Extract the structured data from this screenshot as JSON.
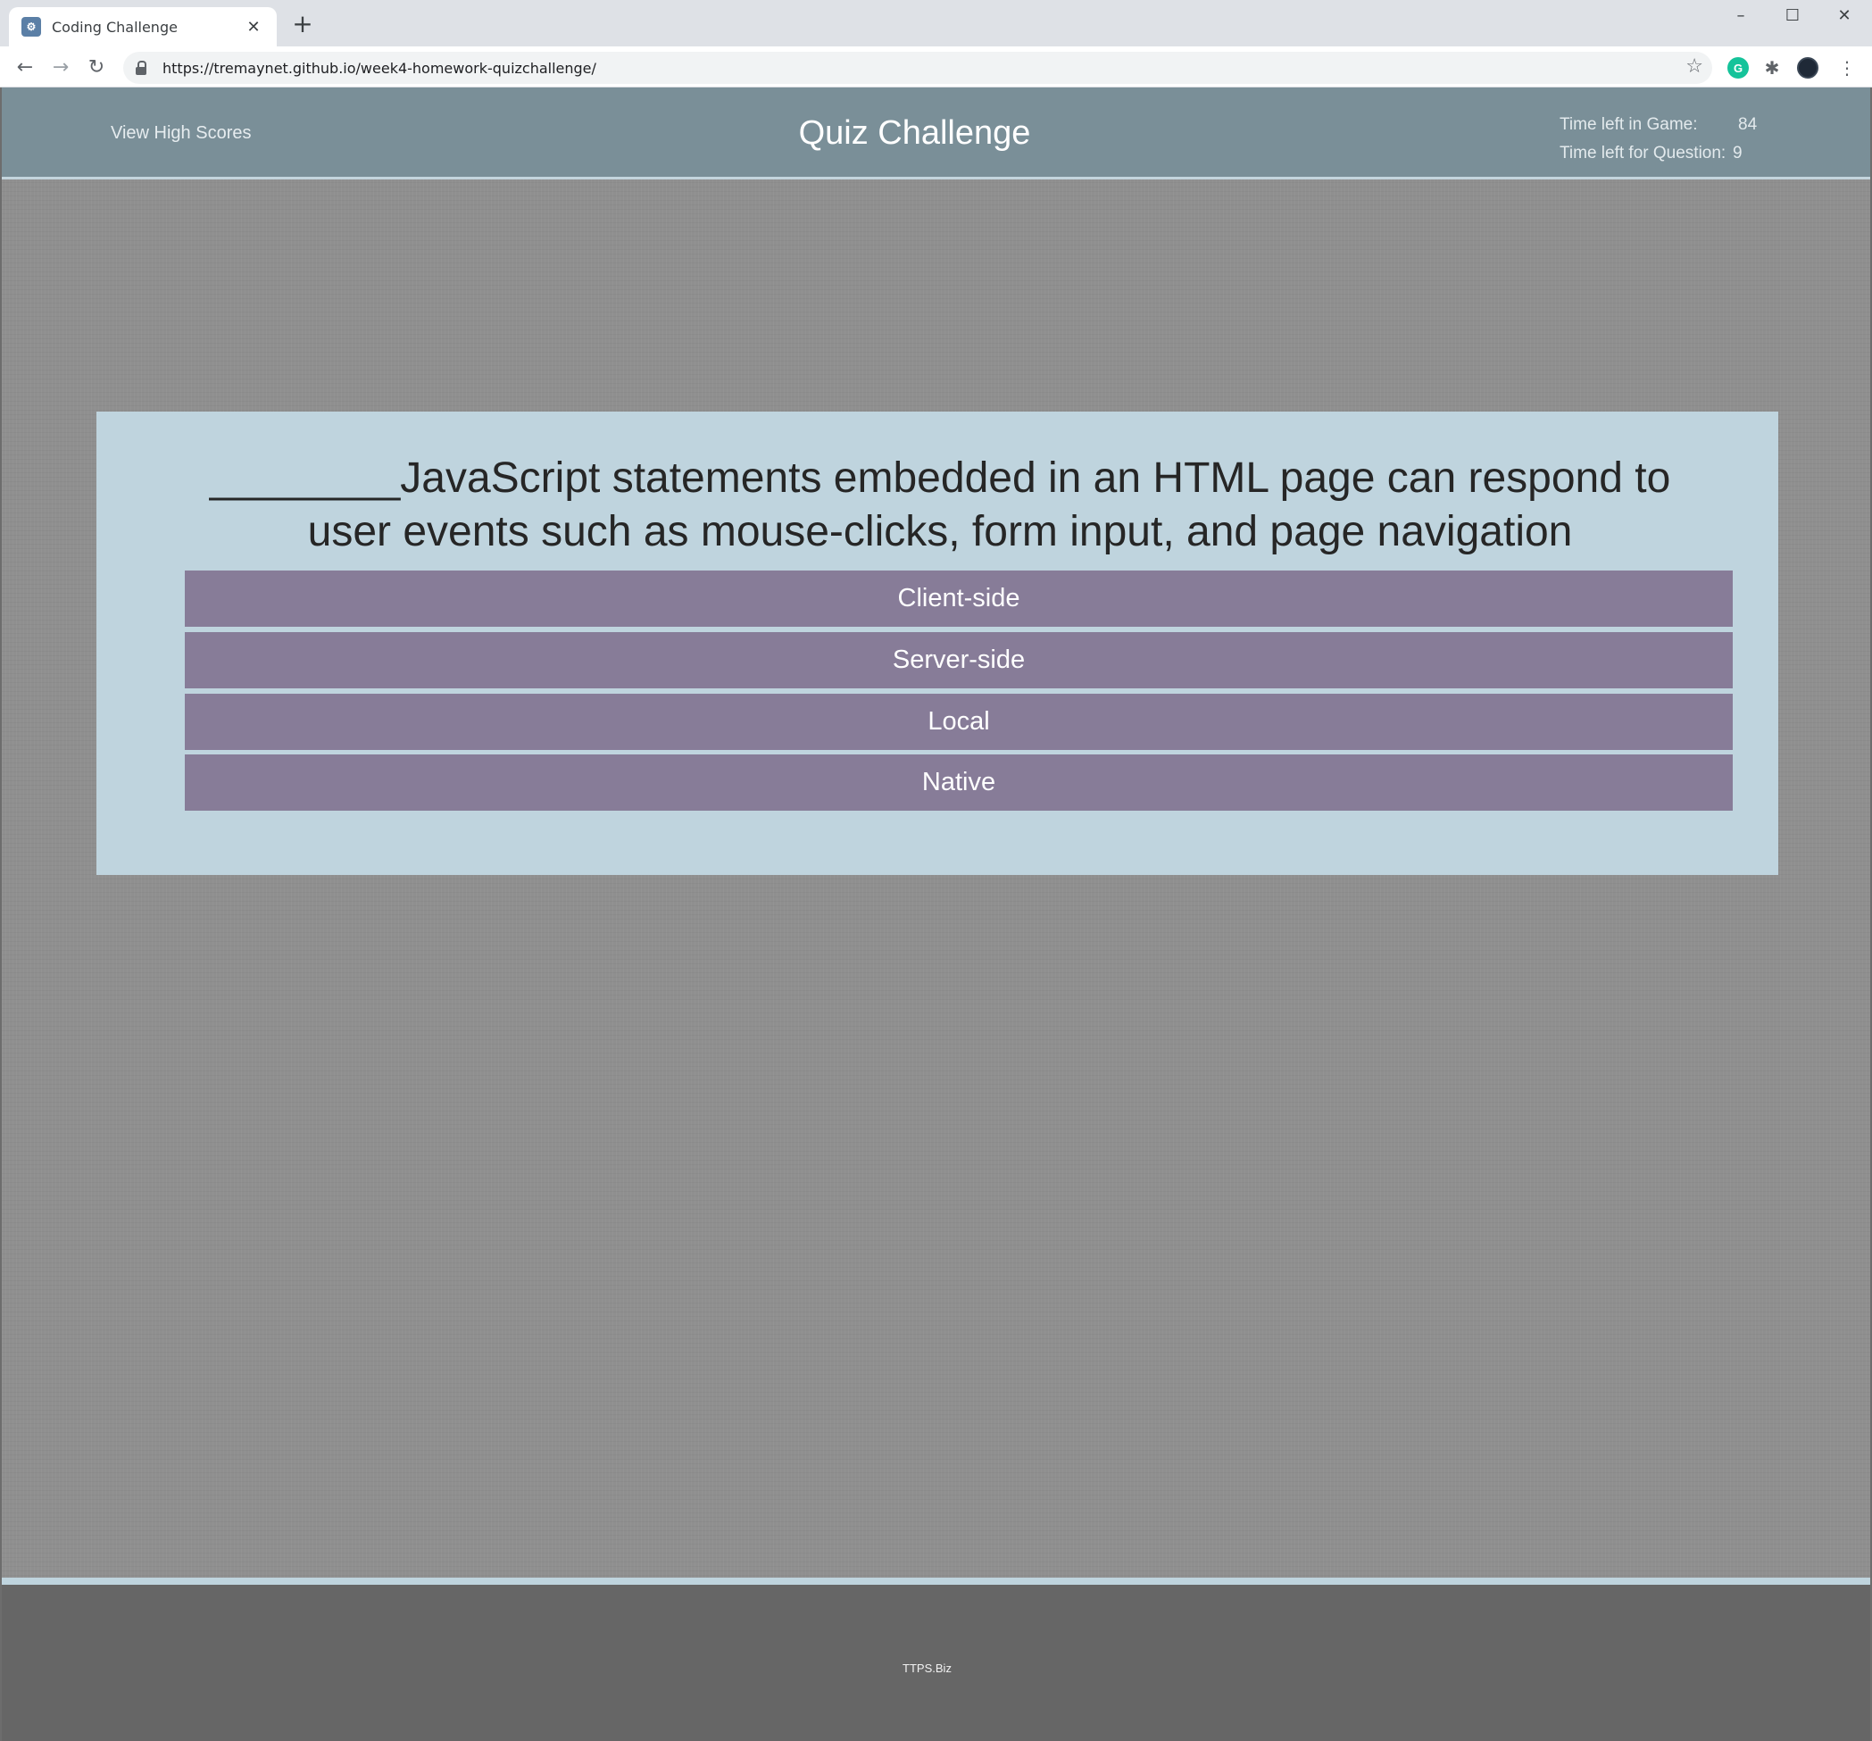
{
  "browser": {
    "tab_title": "Coding Challenge",
    "tab_close": "✕",
    "new_tab": "+",
    "url": "https://tremaynet.github.io/week4-homework-quizchallenge/",
    "window_controls": {
      "minimize": "–",
      "maximize": "☐",
      "close": "✕"
    },
    "nav": {
      "back": "←",
      "forward": "→",
      "reload": "↻"
    },
    "icons": [
      "tab-favicon",
      "lock-icon",
      "star-icon",
      "grammarly-icon",
      "extensions-icon",
      "avatar",
      "menu-icon"
    ]
  },
  "header": {
    "view_high_scores": "View High Scores",
    "title": "Quiz Challenge",
    "time_game_label": "Time left in Game:",
    "time_game_value": "84",
    "time_question_label": "Time left for Question:",
    "time_question_value": "9"
  },
  "quiz": {
    "question": "________JavaScript statements embedded in an HTML page can respond to user events such as mouse-clicks, form input, and page navigation",
    "choices": [
      "Client-side",
      "Server-side",
      "Local",
      "Native"
    ]
  },
  "footer": {
    "text": "TTPS.Biz"
  },
  "colors": {
    "header_bg": "#7a8f98",
    "page_bg": "#8f8f8f",
    "card_bg": "#bfd4de",
    "choice_bg": "#877c98",
    "footer_bg": "#666666"
  }
}
